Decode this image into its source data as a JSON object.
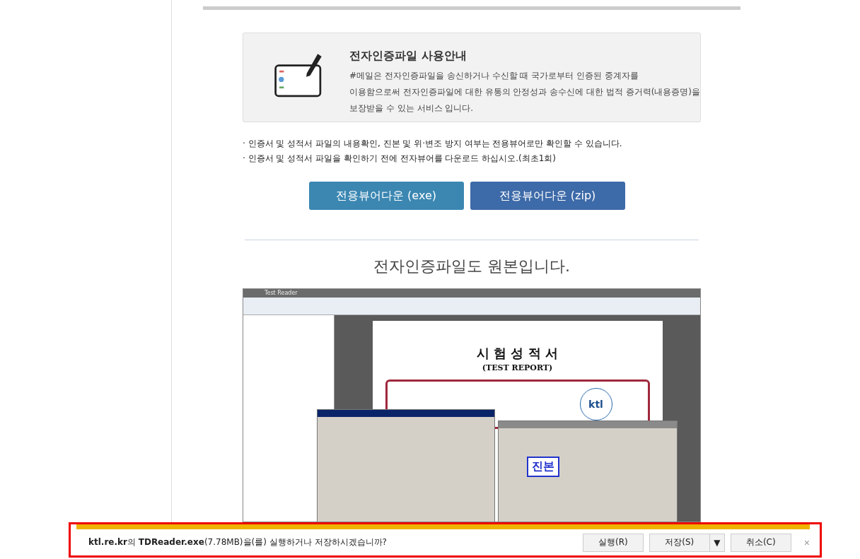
{
  "info_box": {
    "title": "전자인증파일 사용안내",
    "lines": [
      "#메일은 전자인증파일을 송신하거나 수신할 때 국가로부터 인증된 중계자를",
      "이용함으로써 전자인증파일에 대한 유통의 안정성과 송수신에 대한 법적 증거력(내용증명)을",
      "보장받을 수 있는 서비스 입니다."
    ]
  },
  "notes": [
    "· 인증서 및 성적서 파일의 내용확인, 진본 및 위·변조 방지 여부는 전용뷰어로만 확인할 수 있습니다.",
    "· 인증서 및 성적서 파일을 확인하기 전에 전자뷰어를 다운로드 하십시오.(최초1회)"
  ],
  "download_buttons": [
    {
      "label": "전용뷰어다운 (exe)",
      "kind": "exe"
    },
    {
      "label": "전용뷰어다운 (zip)",
      "kind": "zip"
    }
  ],
  "heading": "전자인증파일도 원본입니다.",
  "screenshot": {
    "title": "Test Reader",
    "doc_title": "시 험 성 적 서",
    "doc_subtitle": "(TEST REPORT)",
    "logo": "ktl",
    "stamp": "진본"
  },
  "download_bar": {
    "message": "**ktl.re.kr**의 **TDReader.exe**(7.78MB)을(를) 실행하거나 저장하시겠습니까?",
    "buttons": [
      {
        "label": "실행(R)",
        "kind": "run"
      },
      {
        "label": "저장(S)",
        "kind": "save"
      },
      {
        "label": "▼",
        "kind": "menu"
      },
      {
        "label": "취소(C)",
        "kind": "cancel"
      }
    ],
    "close": "×"
  }
}
